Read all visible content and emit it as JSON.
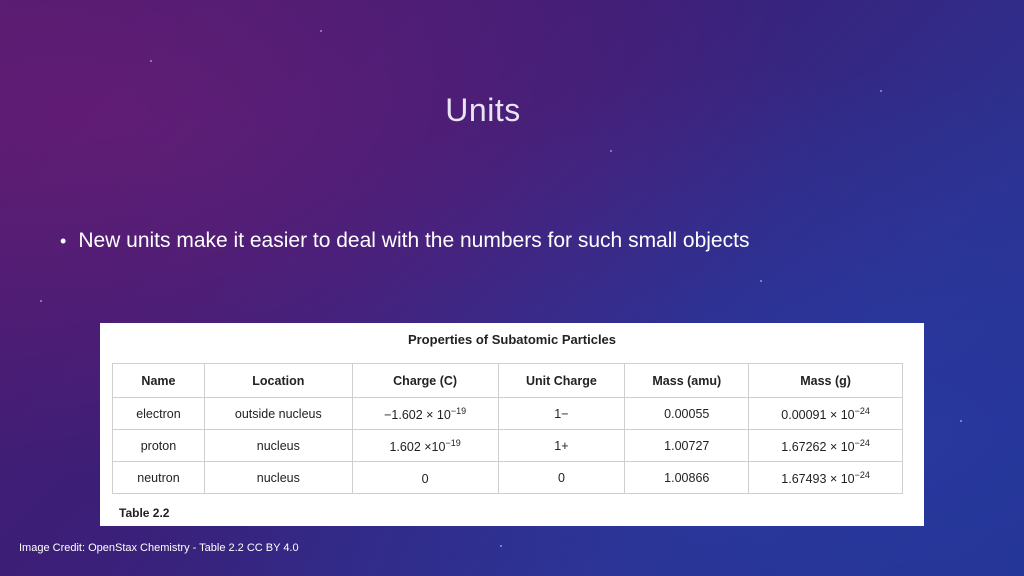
{
  "slide": {
    "title": "Units",
    "bullets": [
      "New units make it easier to deal with the numbers for such small objects"
    ],
    "credit": "Image Credit: OpenStax Chemistry - Table 2.2 CC BY 4.0"
  },
  "table": {
    "title": "Properties of Subatomic Particles",
    "label": "Table 2.2",
    "headers": [
      "Name",
      "Location",
      "Charge (C)",
      "Unit Charge",
      "Mass (amu)",
      "Mass (g)"
    ],
    "rows": [
      {
        "name": "electron",
        "location": "outside nucleus",
        "charge_base": "−1.602 × 10",
        "charge_exp": "−19",
        "unit_charge": "1−",
        "mass_amu": "0.00055",
        "mass_g_base": "0.00091 × 10",
        "mass_g_exp": "−24"
      },
      {
        "name": "proton",
        "location": "nucleus",
        "charge_base": "1.602 ×10",
        "charge_exp": "−19",
        "unit_charge": "1+",
        "mass_amu": "1.00727",
        "mass_g_base": "1.67262 × 10",
        "mass_g_exp": "−24"
      },
      {
        "name": "neutron",
        "location": "nucleus",
        "charge_base": "0",
        "charge_exp": "",
        "unit_charge": "0",
        "mass_amu": "1.00866",
        "mass_g_base": "1.67493 × 10",
        "mass_g_exp": "−24"
      }
    ]
  }
}
